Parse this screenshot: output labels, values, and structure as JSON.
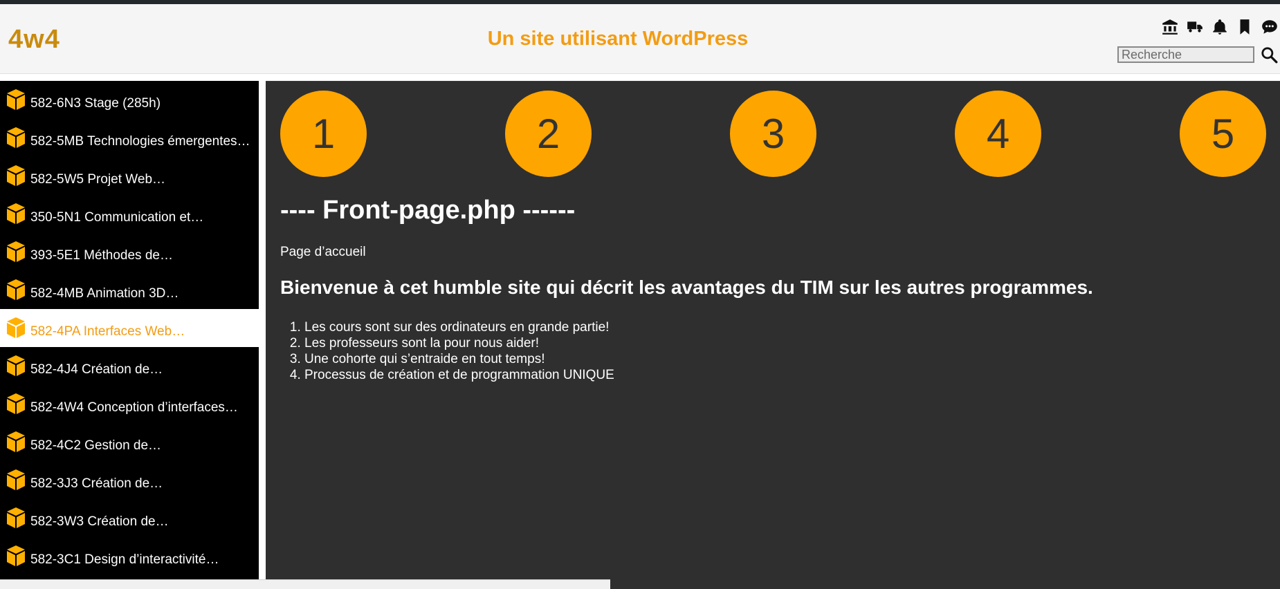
{
  "header": {
    "logo": "4w4",
    "site_title": "Un site utilisant WordPress",
    "icons": [
      "bank-icon",
      "truck-icon",
      "bell-icon",
      "bookmark-icon",
      "chat-icon"
    ],
    "search": {
      "placeholder": "Recherche",
      "value": ""
    }
  },
  "sidebar": {
    "items": [
      {
        "label": "582-6N3 Stage (285h)"
      },
      {
        "label": "582-5MB Technologies émergentes…"
      },
      {
        "label": "582-5W5 Projet Web…"
      },
      {
        "label": "350-5N1 Communication et…"
      },
      {
        "label": "393-5E1 Méthodes de…"
      },
      {
        "label": "582-4MB Animation 3D…"
      },
      {
        "label": "582-4PA Interfaces Web…",
        "active": true
      },
      {
        "label": "582-4J4 Création de…"
      },
      {
        "label": "582-4W4 Conception d’interfaces…"
      },
      {
        "label": "582-4C2 Gestion de…"
      },
      {
        "label": "582-3J3 Création de…"
      },
      {
        "label": "582-3W3 Création de…"
      },
      {
        "label": "582-3C1 Design d’interactivité…"
      }
    ]
  },
  "main": {
    "circles": [
      "1",
      "2",
      "3",
      "4",
      "5"
    ],
    "heading": "---- Front-page.php ------",
    "subtitle": "Page d’accueil",
    "welcome": "Bienvenue à cet humble site qui décrit les avantages du TIM sur les autres programmes.",
    "points": [
      "Les cours sont sur des ordinateurs en grande partie!",
      "Les professeurs sont la pour nous aider!",
      "Une cohorte qui s’entraide en tout temps!",
      "Processus de création et de programmation UNIQUE"
    ]
  },
  "colors": {
    "accent": "#f39c12",
    "circle": "#ffa500",
    "sidebar_bg": "#000000",
    "main_bg": "#2f2f2f"
  }
}
